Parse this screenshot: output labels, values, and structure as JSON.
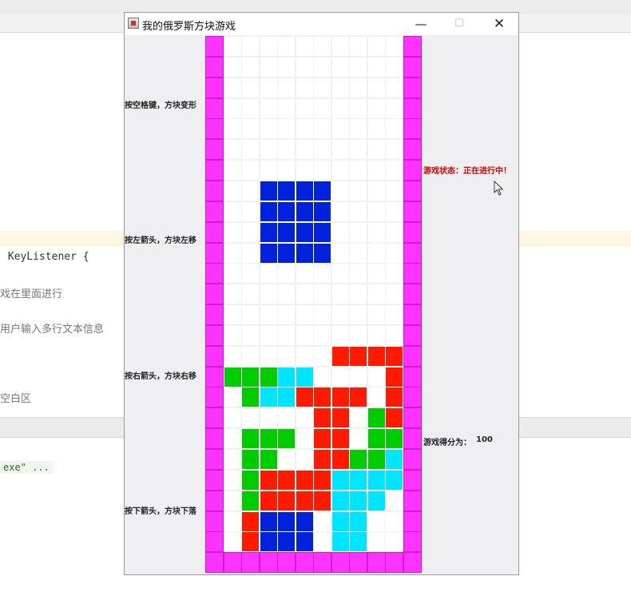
{
  "background_ide": {
    "code_line": " KeyListener {",
    "comment_1": "戏在里面进行",
    "comment_2": "用户输入多行文本信息",
    "comment_3": "空白区",
    "console_text": "exe\" ..."
  },
  "window": {
    "title": "我的俄罗斯方块游戏",
    "minimize_glyph": "—",
    "maximize_glyph": "☐",
    "close_glyph": "✕"
  },
  "hints": {
    "rotate": "按空格键，方块变形",
    "left": "按左箭头，方块左移",
    "right": "按右箭头，方块右移",
    "down": "按下箭头，方块下落"
  },
  "status": {
    "text": "游戏状态：正在进行中！",
    "color": "#d40000"
  },
  "score": {
    "label": "游戏得分为：",
    "value": "100"
  },
  "board": {
    "cols": 12,
    "rows": 26,
    "colors": {
      "wall": "#ff33ff",
      "empty": "#ffffff",
      "B": "#0022dd",
      "G": "#00cc00",
      "C": "#00e5ff",
      "R": "#ff1a00"
    },
    "grid": [
      "W..........W",
      "W..........W",
      "W..........W",
      "W..........W",
      "W..........W",
      "W..........W",
      "W..........W",
      "W..BBBB....W",
      "W..BBBB....W",
      "W..BBBB....W",
      "W..BBBB....W",
      "W..........W",
      "W..........W",
      "W..........W",
      "W..........W",
      "W......RRRRW",
      "WGGGCC....RW",
      "W.GCCRRRR.RW",
      "W.....RR.GRW",
      "W.GGG.RR.GGW",
      "W.GG..RRGGCW",
      "W.GRRRRCCCCW",
      "W.GRRRRCCC.W",
      "W.RBBB.CC..W",
      "W.RBBB.CC..W",
      "WWWWWWWWWWWW"
    ]
  }
}
